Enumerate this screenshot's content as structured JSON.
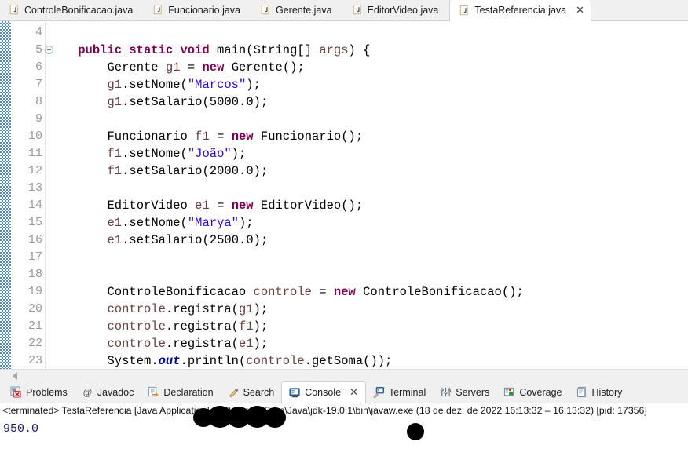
{
  "editor": {
    "tabs": [
      {
        "label": "ControleBonificacao.java",
        "icon": "java-file-icon",
        "active": false,
        "closable": false
      },
      {
        "label": "Funcionario.java",
        "icon": "java-file-icon",
        "active": false,
        "closable": false
      },
      {
        "label": "Gerente.java",
        "icon": "java-file-icon",
        "active": false,
        "closable": false
      },
      {
        "label": "EditorVideo.java",
        "icon": "java-file-icon",
        "active": false,
        "closable": false
      },
      {
        "label": "TestaReferencia.java",
        "icon": "java-file-icon",
        "active": true,
        "closable": true
      }
    ],
    "close_glyph": "✕",
    "line_numbers": [
      "4",
      "5",
      "6",
      "7",
      "8",
      "9",
      "10",
      "11",
      "12",
      "13",
      "14",
      "15",
      "16",
      "17",
      "18",
      "19",
      "20",
      "21",
      "22",
      "23"
    ],
    "fold_marker_line": "5",
    "fold_glyph": "⊖",
    "code_lines": [
      "",
      "    public static void main(String[] args) {",
      "        Gerente g1 = new Gerente();",
      "        g1.setNome(\"Marcos\");",
      "        g1.setSalario(5000.0);",
      "",
      "        Funcionario f1 = new Funcionario();",
      "        f1.setNome(\"João\");",
      "        f1.setSalario(2000.0);",
      "",
      "        EditorVideo e1 = new EditorVideo();",
      "        e1.setNome(\"Marya\");",
      "        e1.setSalario(2500.0);",
      "",
      "",
      "        ControleBonificacao controle = new ControleBonificacao();",
      "        controle.registra(g1);",
      "        controle.registra(f1);",
      "        controle.registra(e1);",
      "        System.out.println(controle.getSoma());"
    ],
    "colors": {
      "keyword": "#7F0055",
      "string": "#2A00FF",
      "local_variable": "#6A3E3E",
      "static_field": "#0000C0",
      "plain": "#000000",
      "line_number": "#9A9A9A",
      "annotation_ruler": "#2E74B5"
    }
  },
  "console": {
    "tabs": [
      {
        "label": "Problems",
        "icon": "problems-icon",
        "active": false,
        "closable": false
      },
      {
        "label": "Javadoc",
        "icon": "javadoc-icon",
        "active": false,
        "closable": false
      },
      {
        "label": "Declaration",
        "icon": "declaration-icon",
        "active": false,
        "closable": false
      },
      {
        "label": "Search",
        "icon": "search-icon",
        "active": false,
        "closable": false
      },
      {
        "label": "Console",
        "icon": "console-icon",
        "active": true,
        "closable": true
      },
      {
        "label": "Terminal",
        "icon": "terminal-icon",
        "active": false,
        "closable": false
      },
      {
        "label": "Servers",
        "icon": "servers-icon",
        "active": false,
        "closable": false
      },
      {
        "label": "Coverage",
        "icon": "coverage-icon",
        "active": false,
        "closable": false
      },
      {
        "label": "History",
        "icon": "history-icon",
        "active": false,
        "closable": false
      }
    ],
    "close_glyph": "✕",
    "terminated_line": "<terminated> TestaReferencia [Java Application] C:\\Program Files\\Java\\jdk-19.0.1\\bin\\javaw.exe  (18 de dez. de 2022 16:13:32 – 16:13:32) [pid: 17356]",
    "output": "950.0",
    "output_color": "#1B1B6E"
  }
}
